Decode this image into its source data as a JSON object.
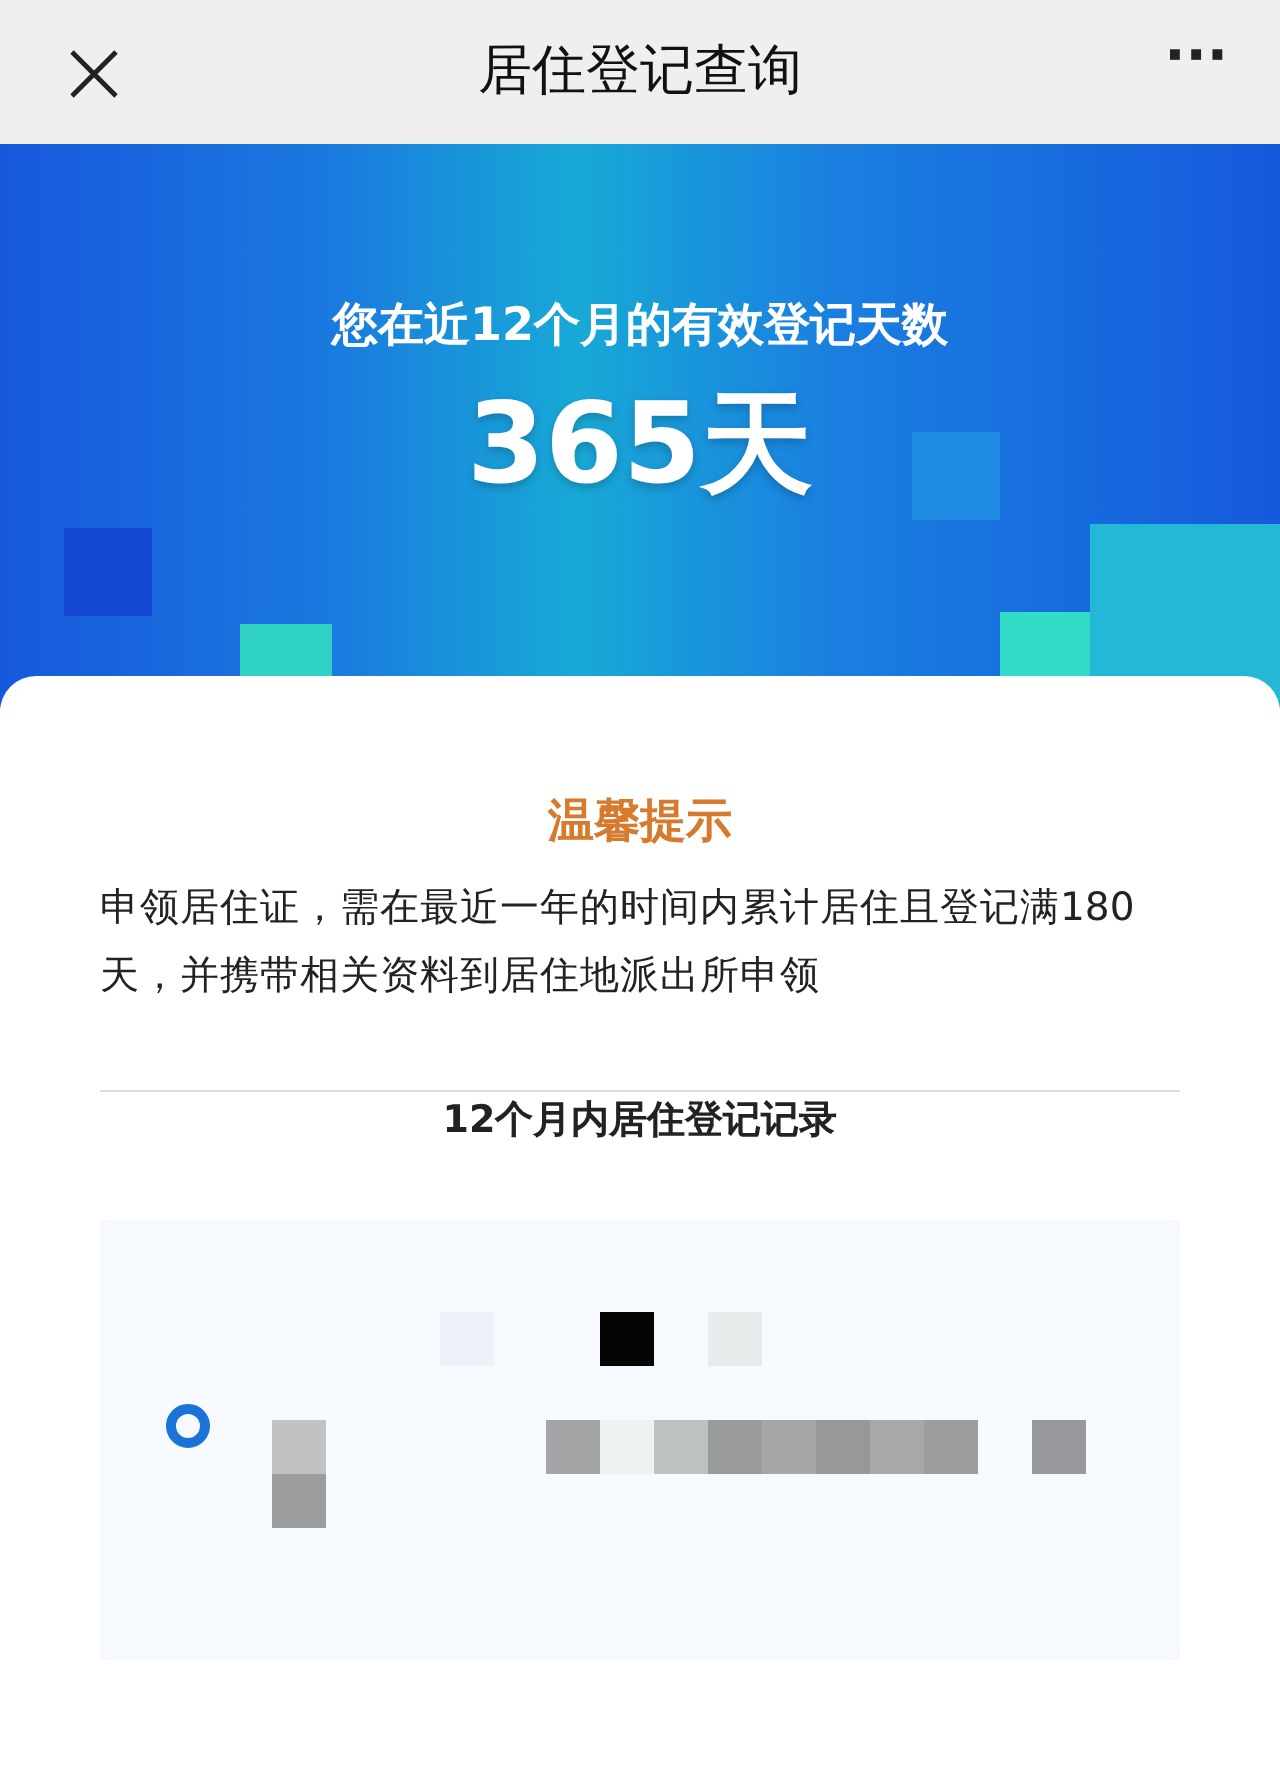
{
  "top_bar": {
    "title": "居住登记查询",
    "more": "···"
  },
  "banner": {
    "caption": "您在近12个月的有效登记天数",
    "days": "365天"
  },
  "tips": {
    "title": "温馨提示",
    "text": "申领居住证，需在最近一年的时间内累计居住且登记满180天，并携带相关资料到居住地派出所申领"
  },
  "records": {
    "title": "12个月内居住登记记录"
  }
}
